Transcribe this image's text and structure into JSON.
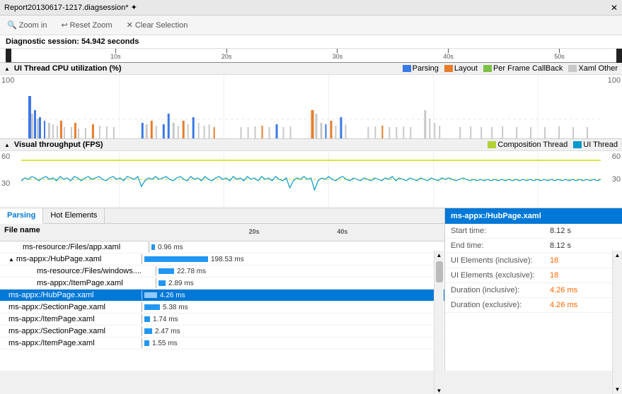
{
  "titleBar": {
    "text": "Report20130617-1217.diagsession* ✦",
    "close": "✕"
  },
  "toolbar": {
    "zoomIn": "Zoom in",
    "resetZoom": "Reset Zoom",
    "clearSelection": "Clear Selection"
  },
  "diagnosticSession": {
    "label": "Diagnostic session:",
    "duration": "54.942 seconds"
  },
  "ruler": {
    "ticks": [
      "10s",
      "20s",
      "30s",
      "40s",
      "50s"
    ],
    "positions": [
      17,
      36,
      55,
      74,
      93
    ]
  },
  "cpuChart": {
    "title": "UI Thread CPU utilization (%)",
    "yMax": "100",
    "yMin": "100",
    "legend": [
      {
        "label": "Parsing",
        "color": "#3b78e7"
      },
      {
        "label": "Layout",
        "color": "#e87c2b"
      },
      {
        "label": "Per Frame CallBack",
        "color": "#7dc243"
      },
      {
        "label": "Xaml Other",
        "color": "#c8c8c8"
      }
    ]
  },
  "fpsChart": {
    "title": "Visual throughput (FPS)",
    "y60": "60",
    "y30": "30",
    "legend": [
      {
        "label": "Composition Thread",
        "color": "#b2d235"
      },
      {
        "label": "UI Thread",
        "color": "#0099cc"
      }
    ]
  },
  "tabs": [
    {
      "label": "Parsing",
      "active": true
    },
    {
      "label": "Hot Elements",
      "active": false
    }
  ],
  "tableHeader": {
    "fileName": "File name",
    "timeline": ""
  },
  "miniRuler": {
    "ticks": [
      "20s",
      "40s"
    ],
    "positions": [
      40,
      70
    ]
  },
  "tableRows": [
    {
      "indent": 1,
      "name": "ms-resource:/Files/app.xaml",
      "ms": "0.96 ms",
      "barWidth": 5,
      "selected": false,
      "hasCollapse": false
    },
    {
      "indent": 0,
      "name": "▲ ms-appx:/HubPage.xaml",
      "ms": "198.53 ms",
      "barWidth": 90,
      "selected": false,
      "hasCollapse": true
    },
    {
      "indent": 1,
      "name": "ms-resource:/Files/windows....",
      "ms": "22.78 ms",
      "barWidth": 22,
      "selected": false,
      "hasCollapse": false
    },
    {
      "indent": 1,
      "name": "ms-appx:/ItemPage.xaml",
      "ms": "2.89 ms",
      "barWidth": 10,
      "selected": false,
      "hasCollapse": false
    },
    {
      "indent": 0,
      "name": "ms-appx:/HubPage.xaml",
      "ms": "4.26 ms",
      "barWidth": 18,
      "selected": true,
      "hasCollapse": false
    },
    {
      "indent": 0,
      "name": "ms-appx:/SectionPage.xaml",
      "ms": "5.38 ms",
      "barWidth": 22,
      "selected": false,
      "hasCollapse": false
    },
    {
      "indent": 0,
      "name": "ms-appx:/ItemPage.xaml",
      "ms": "1.74 ms",
      "barWidth": 8,
      "selected": false,
      "hasCollapse": false
    },
    {
      "indent": 0,
      "name": "ms-appx:/SectionPage.xaml",
      "ms": "2.47 ms",
      "barWidth": 11,
      "selected": false,
      "hasCollapse": false
    },
    {
      "indent": 0,
      "name": "ms-appx:/ItemPage.xaml",
      "ms": "1.55 ms",
      "barWidth": 7,
      "selected": false,
      "hasCollapse": false
    }
  ],
  "detailPanel": {
    "title": "ms-appx:/HubPage.xaml",
    "fields": [
      {
        "label": "Start time:",
        "value": "8.12 s",
        "orange": false
      },
      {
        "label": "End time:",
        "value": "8.12 s",
        "orange": false
      },
      {
        "label": "UI Elements (inclusive):",
        "value": "18",
        "orange": true
      },
      {
        "label": "UI Elements (exclusive):",
        "value": "18",
        "orange": true
      },
      {
        "label": "Duration (inclusive):",
        "value": "4.26 ms",
        "orange": true
      },
      {
        "label": "Duration (exclusive):",
        "value": "4.26 ms",
        "orange": true
      }
    ]
  },
  "colors": {
    "accent": "#0078d7",
    "orange": "#ff6600",
    "selected": "#0078d7"
  }
}
